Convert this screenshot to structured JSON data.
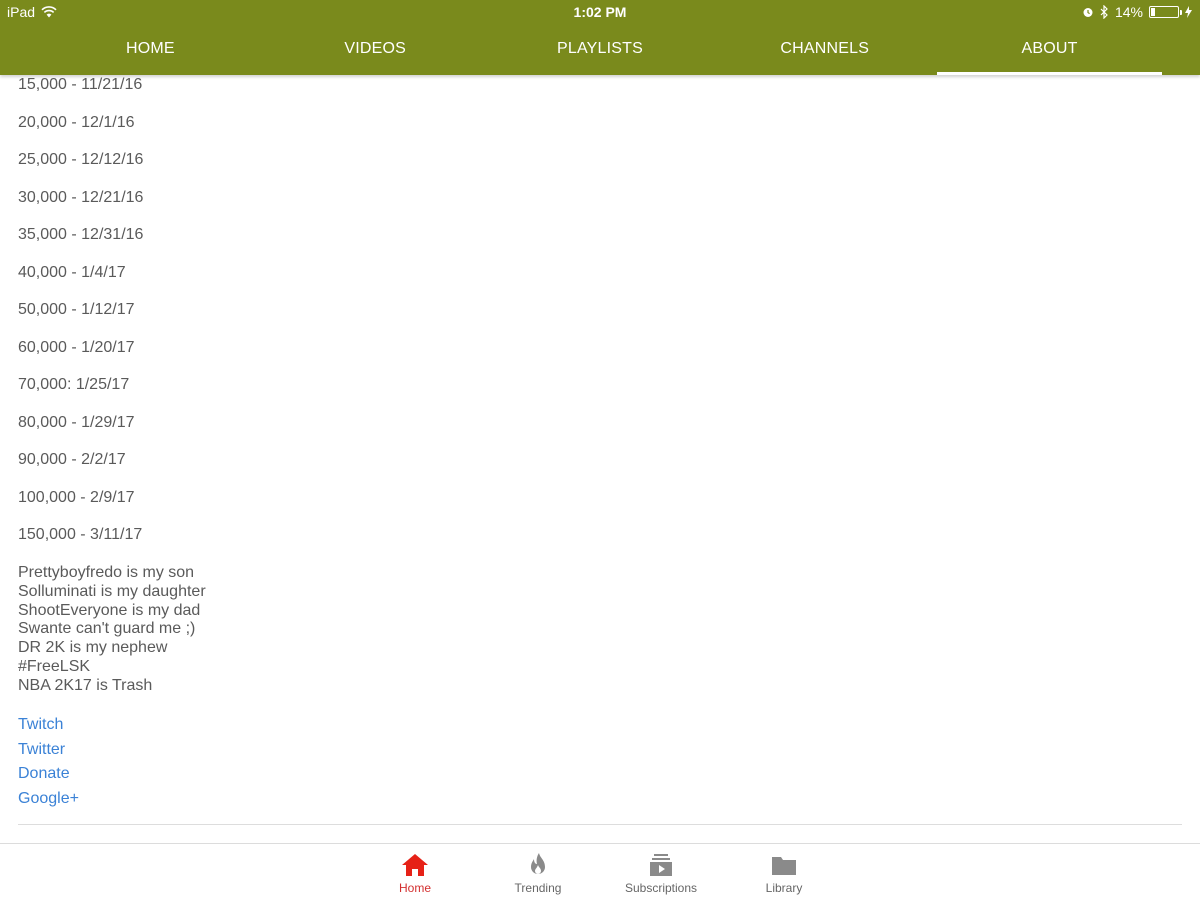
{
  "status_bar": {
    "device": "iPad",
    "time": "1:02 PM",
    "battery": "14%",
    "battery_fraction": 0.14
  },
  "tabs": [
    {
      "label": "HOME",
      "active": false
    },
    {
      "label": "VIDEOS",
      "active": false
    },
    {
      "label": "PLAYLISTS",
      "active": false
    },
    {
      "label": "CHANNELS",
      "active": false
    },
    {
      "label": "ABOUT",
      "active": true
    }
  ],
  "colors": {
    "app_bar": "#7a8a1c",
    "link": "#3b82d6",
    "active_nav": "#d32f2f",
    "body_text": "#5a5a5a"
  },
  "about": {
    "milestones": [
      "15,000 - 11/21/16",
      "20,000 - 12/1/16",
      "25,000 - 12/12/16",
      "30,000 - 12/21/16",
      "35,000 - 12/31/16",
      "40,000 - 1/4/17",
      "50,000 - 1/12/17",
      "60,000 - 1/20/17",
      "70,000: 1/25/17",
      "80,000 - 1/29/17",
      "90,000 - 2/2/17",
      "100,000 - 2/9/17",
      "150,000 - 3/11/17"
    ],
    "lines": [
      "Prettyboyfredo is my son",
      "Solluminati is my daughter",
      "ShootEveryone is my dad",
      "Swante can't guard me ;)",
      "DR 2K is my nephew",
      "#FreeLSK",
      "NBA 2K17 is Trash"
    ],
    "links": [
      "Twitch",
      "Twitter",
      "Donate",
      "Google+"
    ]
  },
  "bottom_nav": [
    {
      "label": "Home",
      "icon": "home-icon",
      "active": true
    },
    {
      "label": "Trending",
      "icon": "flame-icon",
      "active": false
    },
    {
      "label": "Subscriptions",
      "icon": "subscriptions-icon",
      "active": false
    },
    {
      "label": "Library",
      "icon": "folder-icon",
      "active": false
    }
  ]
}
